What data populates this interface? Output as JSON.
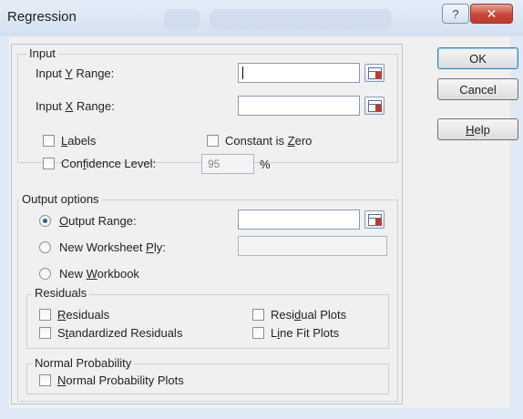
{
  "window": {
    "title": "Regression",
    "help_glyph": "?",
    "close_glyph": "✕"
  },
  "input": {
    "group_label": "Input",
    "y_range": {
      "label_pre": "Input ",
      "label_key": "Y",
      "label_post": " Range:",
      "value": ""
    },
    "x_range": {
      "label_pre": "Input ",
      "label_key": "X",
      "label_post": " Range:",
      "value": ""
    },
    "labels": {
      "key": "L",
      "rest": "abels",
      "checked": false
    },
    "constant_zero": {
      "pre": "Constant is ",
      "key": "Z",
      "post": "ero",
      "checked": false
    },
    "confidence": {
      "pre": "Con",
      "key": "f",
      "post": "idence Level:",
      "checked": false,
      "value": "95",
      "unit": "%"
    }
  },
  "output": {
    "group_label": "Output options",
    "output_range": {
      "key": "O",
      "rest": "utput Range:",
      "selected": true,
      "value": ""
    },
    "new_worksheet": {
      "pre": "New Worksheet ",
      "key": "P",
      "post": "ly:",
      "selected": false,
      "value": ""
    },
    "new_workbook": {
      "pre": "New ",
      "key": "W",
      "post": "orkbook",
      "selected": false
    }
  },
  "residuals": {
    "group_label": "Residuals",
    "residuals": {
      "key": "R",
      "rest": "esiduals",
      "checked": false
    },
    "standardized": {
      "pre": "S",
      "key": "t",
      "post": "andardized Residuals",
      "checked": false
    },
    "residual_plots": {
      "pre": "Resi",
      "key": "d",
      "post": "ual Plots",
      "checked": false
    },
    "line_fit": {
      "pre": "L",
      "key": "i",
      "post": "ne Fit Plots",
      "checked": false
    }
  },
  "normal": {
    "group_label": "Normal Probability",
    "plots": {
      "key": "N",
      "rest": "ormal Probability Plots",
      "checked": false
    }
  },
  "buttons": {
    "ok": "OK",
    "cancel": "Cancel",
    "help_key": "H",
    "help_rest": "elp"
  }
}
